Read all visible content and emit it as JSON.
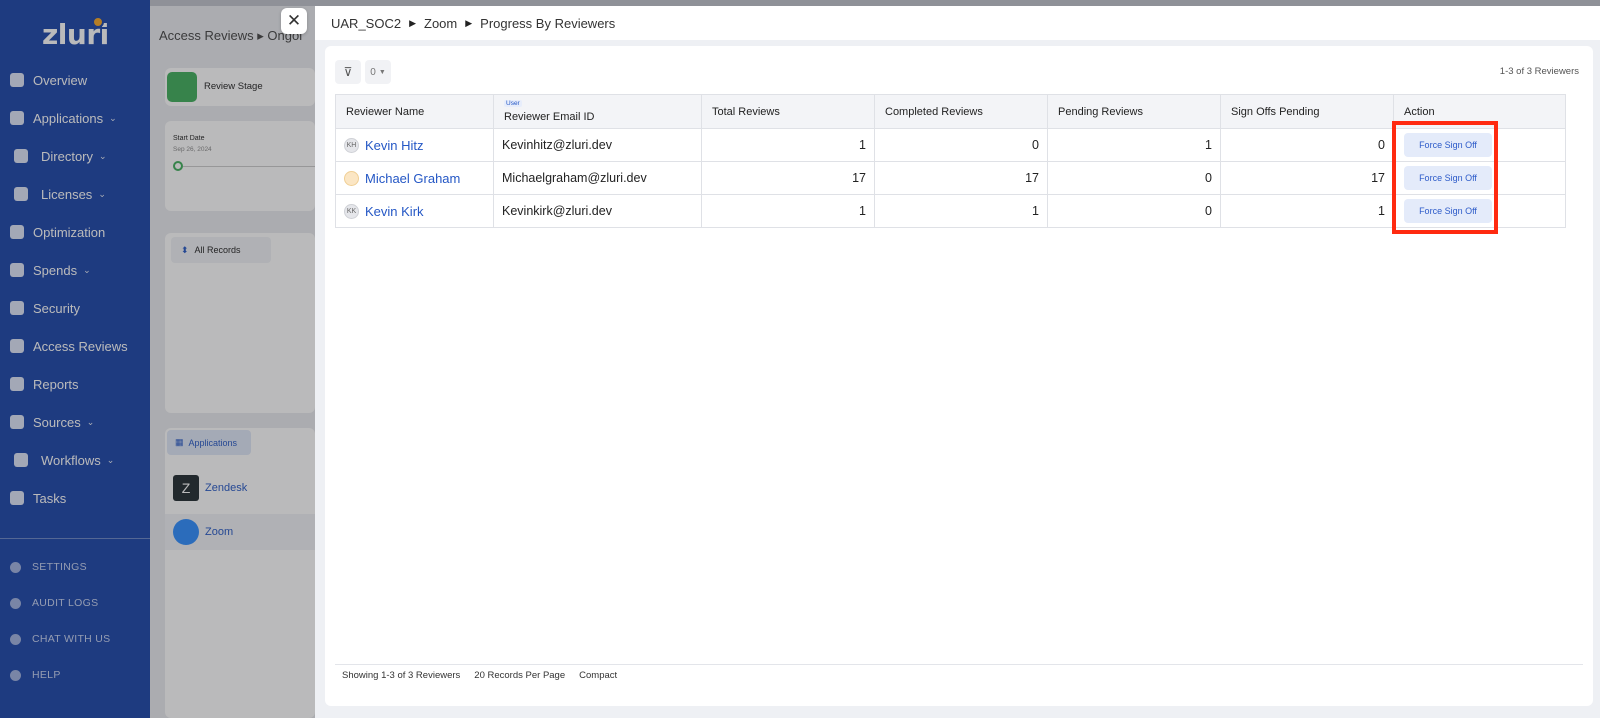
{
  "brand": {
    "name": "zluri"
  },
  "sidebar": {
    "items": [
      {
        "label": "Overview",
        "icon": "grid-icon",
        "chevron": false
      },
      {
        "label": "Applications",
        "icon": "window-icon",
        "chevron": true
      },
      {
        "label": "Directory",
        "icon": "contact-card-icon",
        "chevron": true
      },
      {
        "label": "Licenses",
        "icon": "license-card-icon",
        "chevron": true
      },
      {
        "label": "Optimization",
        "icon": "rocket-icon",
        "chevron": false
      },
      {
        "label": "Spends",
        "icon": "money-icon",
        "chevron": true
      },
      {
        "label": "Security",
        "icon": "shield-icon",
        "chevron": false
      },
      {
        "label": "Access Reviews",
        "icon": "user-check-icon",
        "chevron": false
      },
      {
        "label": "Reports",
        "icon": "report-icon",
        "chevron": false
      },
      {
        "label": "Sources",
        "icon": "source-icon",
        "chevron": true
      },
      {
        "label": "Workflows",
        "icon": "workflow-icon",
        "chevron": true
      },
      {
        "label": "Tasks",
        "icon": "tasks-icon",
        "chevron": false
      }
    ],
    "footer_items": [
      {
        "label": "SETTINGS",
        "icon": "gear-icon"
      },
      {
        "label": "AUDIT LOGS",
        "icon": "audit-icon"
      },
      {
        "label": "CHAT WITH US",
        "icon": "chat-icon"
      },
      {
        "label": "HELP",
        "icon": "help-icon"
      }
    ]
  },
  "background": {
    "breadcrumb": "Access Reviews ▸ Ongoi",
    "review_stage_label": "Review Stage",
    "start_date_label": "Start Date",
    "start_date_value": "Sep 26, 2024",
    "all_records_label": "All Records",
    "applications_label": "Applications",
    "apps": [
      "Zendesk",
      "Zoom"
    ]
  },
  "modal": {
    "breadcrumb": [
      "UAR_SOC2",
      "Zoom",
      "Progress By Reviewers"
    ],
    "filter_count": "0",
    "range_label": "1-3 of 3 Reviewers",
    "columns": {
      "reviewer_name": "Reviewer Name",
      "user_tag": "User",
      "email": "Reviewer Email ID",
      "total": "Total Reviews",
      "completed": "Completed Reviews",
      "pending": "Pending Reviews",
      "signoffs": "Sign Offs Pending",
      "action": "Action"
    },
    "rows": [
      {
        "initials": "KH",
        "name": "Kevin Hitz",
        "email": "Kevinhitz@zluri.dev",
        "total": "1",
        "completed": "0",
        "pending": "1",
        "signoffs": "0",
        "action": "Force Sign Off"
      },
      {
        "initials": "",
        "name": "Michael Graham",
        "email": "Michaelgraham@zluri.dev",
        "total": "17",
        "completed": "17",
        "pending": "0",
        "signoffs": "17",
        "action": "Force Sign Off"
      },
      {
        "initials": "KK",
        "name": "Kevin Kirk",
        "email": "Kevinkirk@zluri.dev",
        "total": "1",
        "completed": "1",
        "pending": "0",
        "signoffs": "1",
        "action": "Force Sign Off"
      }
    ],
    "footer": {
      "showing": "Showing 1-3 of 3 Reviewers",
      "per_page": "20 Records Per Page",
      "density": "Compact"
    }
  },
  "colors": {
    "sidebar": "#1a44a8",
    "link": "#2457c5",
    "highlight": "#ff2a10"
  }
}
